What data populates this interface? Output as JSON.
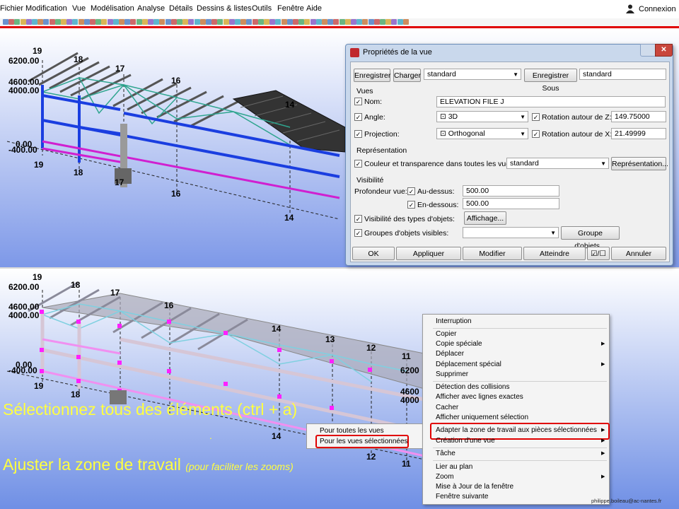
{
  "menu": {
    "items": [
      "Fichier",
      "Modification",
      "Vue",
      "Modélisation",
      "Analyse",
      "Détails",
      "Dessins & listes",
      "Outils",
      "Fenêtre",
      "Aide"
    ],
    "login": "Connexion"
  },
  "viewport_top": {
    "levels": [
      "19",
      "6200.00",
      "4600.00",
      "4000.00",
      "0.00",
      "-400.00",
      "19"
    ],
    "grid_labels": [
      "18",
      "17",
      "16",
      "14",
      "18",
      "17",
      "16",
      "14"
    ]
  },
  "viewport_bottom": {
    "levels": [
      "19",
      "6200.00",
      "4600.00",
      "4000.00",
      "0.00",
      "-400.00",
      "19"
    ],
    "grid_labels": [
      "18",
      "17",
      "16",
      "14",
      "13",
      "12",
      "11",
      "6200",
      "4600",
      "4000",
      "18",
      "14",
      "12",
      "11"
    ]
  },
  "dialog": {
    "title": "Propriétés de la vue",
    "save_button": "Enregistrer",
    "load_button": "Charger",
    "preset_value": "standard",
    "save_as_button": "Enregistrer Sous",
    "save_as_value": "standard",
    "section_views": "Vues",
    "name_label": "Nom:",
    "name_value": "ELEVATION FILE J",
    "angle_label": "Angle:",
    "angle_value": "3D",
    "rot_z_label": "Rotation autour de Z:",
    "rot_z_value": "149.75000",
    "projection_label": "Projection:",
    "projection_value": "Orthogonal",
    "rot_x_label": "Rotation autour de X:",
    "rot_x_value": "21.49999",
    "section_representation": "Représentation",
    "color_label": "Couleur et transparence dans toutes les vues:",
    "color_value": "standard",
    "representation_button": "Représentation...",
    "section_visibility": "Visibilité",
    "depth_label": "Profondeur vue:",
    "above_label": "Au-dessus:",
    "above_value": "500.00",
    "below_label": "En-dessous:",
    "below_value": "500.00",
    "object_types_label": "Visibilité des types d'objets:",
    "display_button": "Affichage...",
    "object_groups_label": "Groupes d'objets visibles:",
    "object_groups_button": "Groupe d'objets...",
    "ok_button": "OK",
    "apply_button": "Appliquer",
    "modify_button": "Modifier",
    "reach_button": "Atteindre",
    "cancel_button": "Annuler"
  },
  "overlay": {
    "select_text": "Sélectionnez tous  des éléments (ctrl + a)",
    "adjust_text": "Ajuster la zone de travail ",
    "adjust_note": "(pour faciliter les zooms)",
    "dot": "."
  },
  "context_menu": {
    "items": [
      "Interruption",
      "Copier",
      "Copie spéciale",
      "Déplacer",
      "Déplacement spécial",
      "Supprimer",
      "Détection des collisions",
      "Afficher avec lignes exactes",
      "Cacher",
      "Afficher uniquement sélection",
      "Adapter la zone de travail aux pièces sélectionnées",
      "Création d'une vue",
      "Tâche",
      "Lier au plan",
      "Zoom",
      "Mise à Jour de la fenêtre",
      "Fenêtre suivante"
    ]
  },
  "submenu": {
    "items": [
      "Pour toutes les vues",
      "Pour les vues sélectionnées"
    ]
  },
  "footer": "philippe.boileau@ac-nantes.fr",
  "colors": {
    "highlight_red": "#e00000",
    "overlay_yellow": "#ffff40",
    "blue_beam": "#1a3ee0",
    "magenta_beam": "#d020d0",
    "sky_top": "#ffffff",
    "sky_bottom": "#7d98e8"
  }
}
